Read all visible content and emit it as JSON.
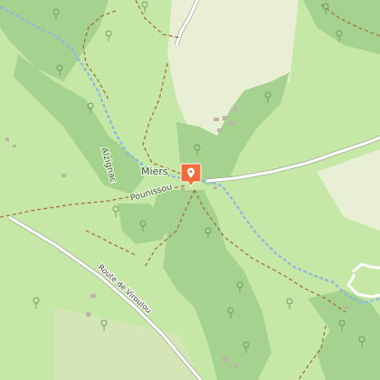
{
  "map": {
    "colors": {
      "meadow": "#c6e8a6",
      "forest": "#a5d28e",
      "water": "#8ab8e2",
      "road": "#ffffff",
      "track": "#a3713e",
      "developed": "#e9efd5",
      "marker": "#f26b3a"
    },
    "labels": {
      "village": "Miers",
      "hamlet": "Pounissou",
      "stream": "Alzignac",
      "road": "Route de Viroulou"
    },
    "marker_icon": "map-pin-icon"
  }
}
